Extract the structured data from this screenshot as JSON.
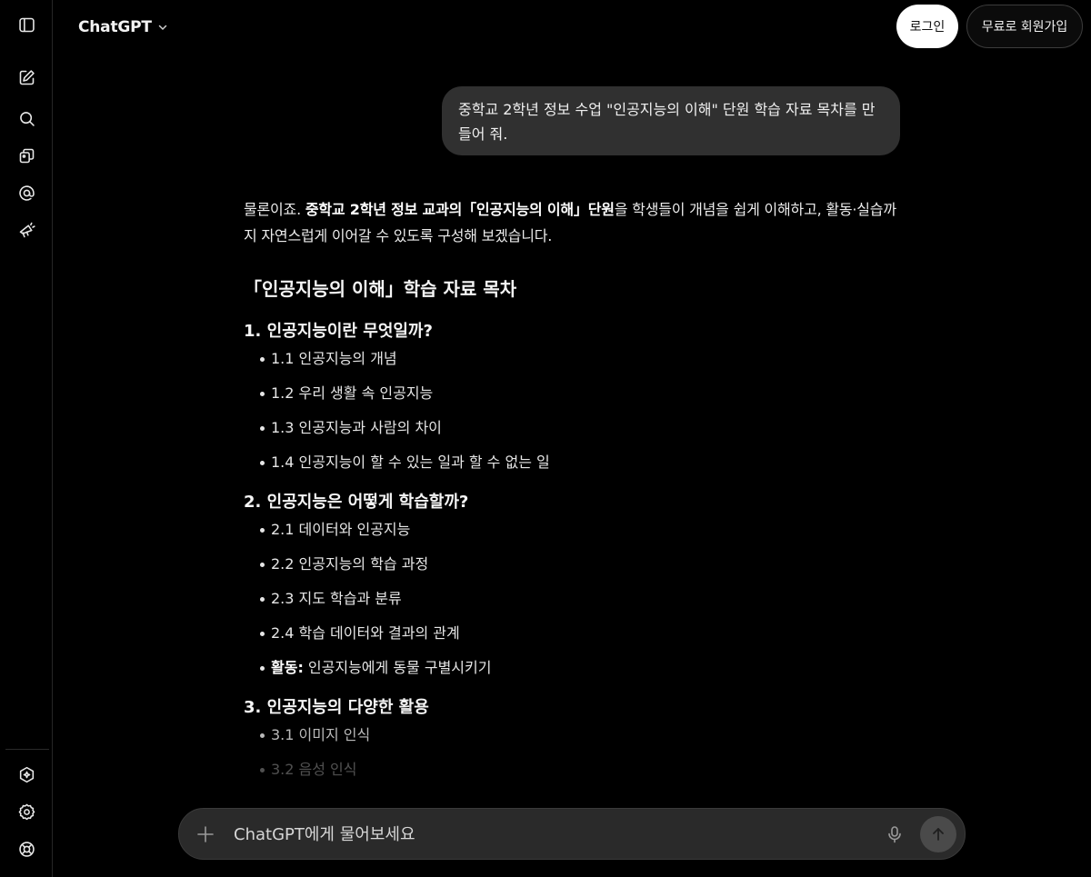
{
  "header": {
    "model_name": "ChatGPT",
    "login_label": "로그인",
    "signup_label": "무료로 회원가입"
  },
  "sidebar": {
    "top_icons": [
      "sidebar-toggle-icon",
      "new-chat-icon",
      "search-icon",
      "library-icon",
      "at-sign-icon",
      "explore-icon"
    ],
    "bottom_icons": [
      "upgrade-icon",
      "gear-icon",
      "help-icon"
    ]
  },
  "conversation": {
    "user_message": "중학교 2학년 정보 수업 \"인공지능의 이해\" 단원 학습 자료 목차를 만들어 줘.",
    "assistant": {
      "intro_parts": [
        "물론이죠. ",
        "중학교 2학년 정보 교과의「인공지능의 이해」단원",
        "을 학생들이 개념을 쉽게 이해하고, 활동·실습까지 자연스럽게 이어갈 수 있도록 구성해 보겠습니다."
      ],
      "doc_title": "「인공지능의 이해」학습 자료 목차",
      "sections": [
        {
          "title": "1. 인공지능이란 무엇일까?",
          "items": [
            "1.1 인공지능의 개념",
            "1.2 우리 생활 속 인공지능",
            "1.3 인공지능과 사람의 차이",
            "1.4 인공지능이 할 수 있는 일과 할 수 없는 일"
          ]
        },
        {
          "title": "2. 인공지능은 어떻게 학습할까?",
          "items": [
            "2.1 데이터와 인공지능",
            "2.2 인공지능의 학습 과정",
            "2.3 지도 학습과 분류",
            "2.4 학습 데이터와 결과의 관계"
          ],
          "activity_label": "활동:",
          "activity_text": " 인공지능에게 동물 구별시키기"
        },
        {
          "title": "3. 인공지능의 다양한 활용",
          "items": [
            "3.1 이미지 인식",
            "3.2 음성 인식"
          ]
        }
      ]
    }
  },
  "composer": {
    "placeholder": "ChatGPT에게 물어보세요"
  }
}
